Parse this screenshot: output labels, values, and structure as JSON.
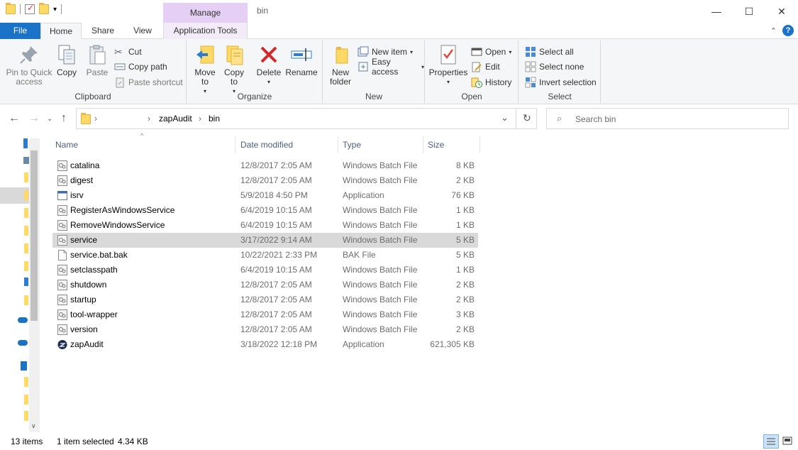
{
  "window": {
    "title": "bin",
    "contextual_tab_group": "Manage",
    "controls": {
      "minimize": "—",
      "maximize": "☐",
      "close": "✕"
    }
  },
  "tabs": {
    "file": "File",
    "home": "Home",
    "share": "Share",
    "view": "View",
    "application_tools": "Application Tools"
  },
  "ribbon": {
    "clipboard": {
      "label": "Clipboard",
      "pin": "Pin to Quick access",
      "copy": "Copy",
      "paste": "Paste",
      "cut": "Cut",
      "copy_path": "Copy path",
      "paste_shortcut": "Paste shortcut"
    },
    "organize": {
      "label": "Organize",
      "move_to": "Move to",
      "copy_to": "Copy to",
      "delete": "Delete",
      "rename": "Rename"
    },
    "new": {
      "label": "New",
      "new_folder": "New folder",
      "new_item": "New item",
      "easy_access": "Easy access"
    },
    "open": {
      "label": "Open",
      "properties": "Properties",
      "open": "Open",
      "edit": "Edit",
      "history": "History"
    },
    "select": {
      "label": "Select",
      "select_all": "Select all",
      "select_none": "Select none",
      "invert_selection": "Invert selection"
    }
  },
  "address": {
    "separator": "›",
    "crumbs": [
      "zapAudit",
      "bin"
    ],
    "search_placeholder": "Search bin"
  },
  "columns": {
    "name": "Name",
    "date": "Date modified",
    "type": "Type",
    "size": "Size"
  },
  "files": [
    {
      "name": "catalina",
      "date": "12/8/2017 2:05 AM",
      "type": "Windows Batch File",
      "size": "8 KB",
      "icon": "batch-file-icon"
    },
    {
      "name": "digest",
      "date": "12/8/2017 2:05 AM",
      "type": "Windows Batch File",
      "size": "2 KB",
      "icon": "batch-file-icon"
    },
    {
      "name": "isrv",
      "date": "5/9/2018 4:50 PM",
      "type": "Application",
      "size": "76 KB",
      "icon": "application-icon"
    },
    {
      "name": "RegisterAsWindowsService",
      "date": "6/4/2019 10:15 AM",
      "type": "Windows Batch File",
      "size": "1 KB",
      "icon": "batch-file-icon"
    },
    {
      "name": "RemoveWindowsService",
      "date": "6/4/2019 10:15 AM",
      "type": "Windows Batch File",
      "size": "1 KB",
      "icon": "batch-file-icon"
    },
    {
      "name": "service",
      "date": "3/17/2022 9:14 AM",
      "type": "Windows Batch File",
      "size": "5 KB",
      "icon": "batch-file-icon",
      "selected": true
    },
    {
      "name": "service.bat.bak",
      "date": "10/22/2021 2:33 PM",
      "type": "BAK File",
      "size": "5 KB",
      "icon": "blank-file-icon"
    },
    {
      "name": "setclasspath",
      "date": "6/4/2019 10:15 AM",
      "type": "Windows Batch File",
      "size": "1 KB",
      "icon": "batch-file-icon"
    },
    {
      "name": "shutdown",
      "date": "12/8/2017 2:05 AM",
      "type": "Windows Batch File",
      "size": "2 KB",
      "icon": "batch-file-icon"
    },
    {
      "name": "startup",
      "date": "12/8/2017 2:05 AM",
      "type": "Windows Batch File",
      "size": "2 KB",
      "icon": "batch-file-icon"
    },
    {
      "name": "tool-wrapper",
      "date": "12/8/2017 2:05 AM",
      "type": "Windows Batch File",
      "size": "3 KB",
      "icon": "batch-file-icon"
    },
    {
      "name": "version",
      "date": "12/8/2017 2:05 AM",
      "type": "Windows Batch File",
      "size": "2 KB",
      "icon": "batch-file-icon"
    },
    {
      "name": "zapAudit",
      "date": "3/18/2022 12:18 PM",
      "type": "Application",
      "size": "621,305 KB",
      "icon": "zapaudit-app-icon"
    }
  ],
  "status": {
    "item_count": "13 items",
    "selection": "1 item selected",
    "selection_size": "4.34 KB"
  },
  "colors": {
    "accent": "#1a73c8",
    "manage_tab": "#e6cff5",
    "selected_row": "#d9d9d9"
  }
}
